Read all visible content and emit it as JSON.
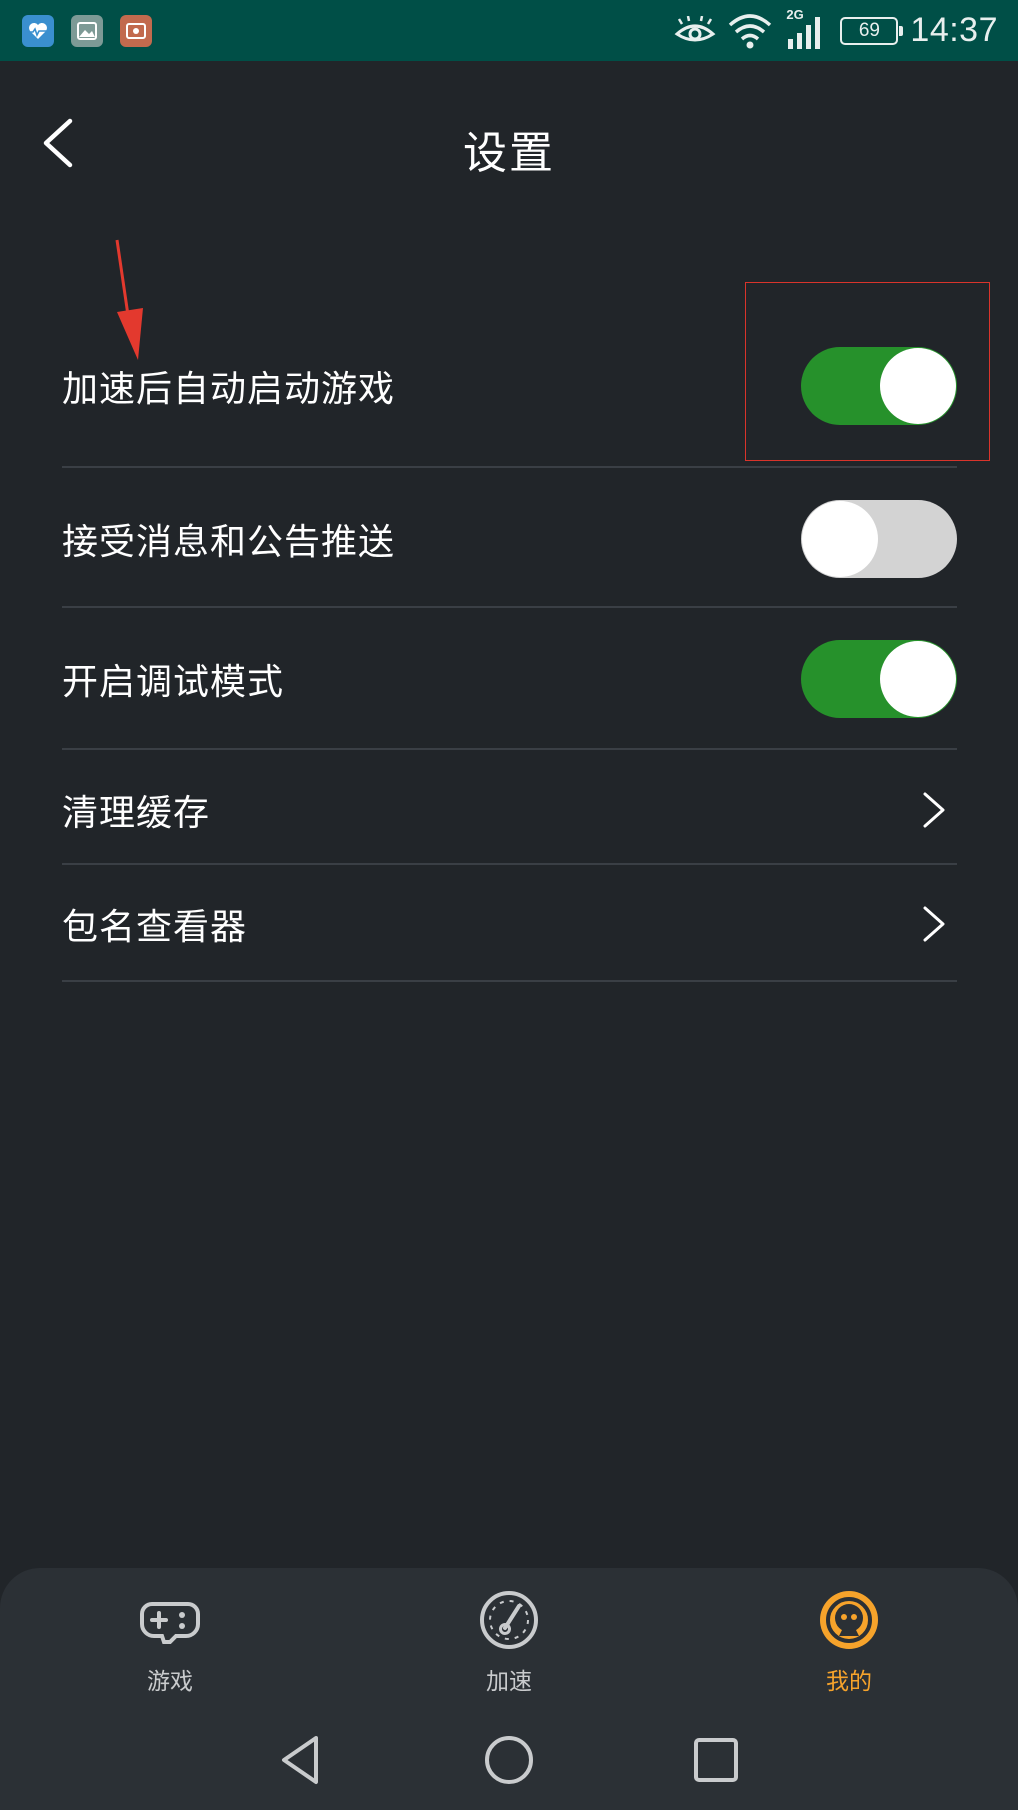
{
  "status_bar": {
    "network_type": "2G",
    "battery_level": "69",
    "time": "14:37"
  },
  "header": {
    "title": "设置"
  },
  "settings": [
    {
      "label": "加速后自动启动游戏",
      "type": "toggle",
      "enabled": true
    },
    {
      "label": "接受消息和公告推送",
      "type": "toggle",
      "enabled": false
    },
    {
      "label": "开启调试模式",
      "type": "toggle",
      "enabled": true
    },
    {
      "label": "清理缓存",
      "type": "link"
    },
    {
      "label": "包名查看器",
      "type": "link"
    }
  ],
  "tabs": [
    {
      "label": "游戏",
      "icon": "gamepad-icon",
      "active": false
    },
    {
      "label": "加速",
      "icon": "speedometer-icon",
      "active": false
    },
    {
      "label": "我的",
      "icon": "profile-icon",
      "active": true
    }
  ],
  "colors": {
    "background": "#212529",
    "status_bar": "#004f47",
    "toggle_on": "#26912b",
    "toggle_off": "#d3d3d3",
    "active_tab": "#f6a32b",
    "annotation": "#d9342b"
  }
}
